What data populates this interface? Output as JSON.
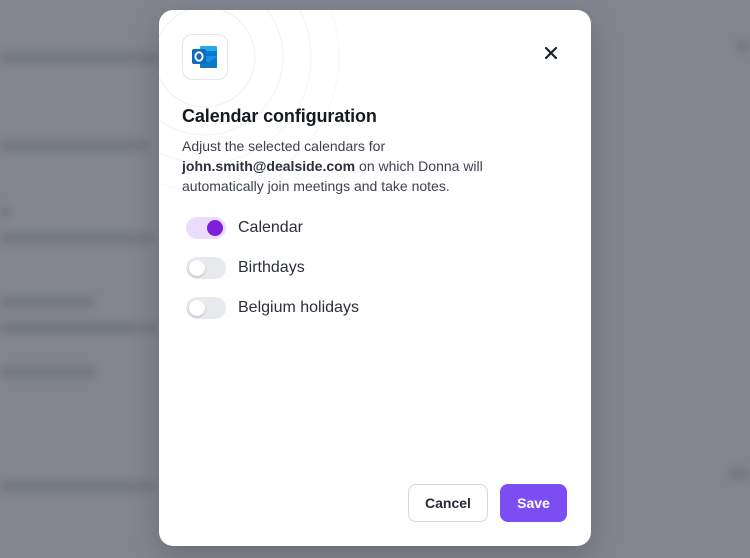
{
  "dialog": {
    "title": "Calendar configuration",
    "description_prefix": "Adjust the selected calendars for",
    "email": "john.smith@dealside.com",
    "description_suffix": "on which Donna will automatically join meetings and take notes.",
    "app_icon": "outlook-icon",
    "close_icon": "close-icon"
  },
  "calendars": [
    {
      "label": "Calendar",
      "enabled": true
    },
    {
      "label": "Birthdays",
      "enabled": false
    },
    {
      "label": "Belgium holidays",
      "enabled": false
    }
  ],
  "actions": {
    "cancel_label": "Cancel",
    "save_label": "Save"
  },
  "colors": {
    "accent": "#7c4df2",
    "toggle_on_knob": "#7f1fd9",
    "toggle_on_track": "#ebdcfb"
  }
}
